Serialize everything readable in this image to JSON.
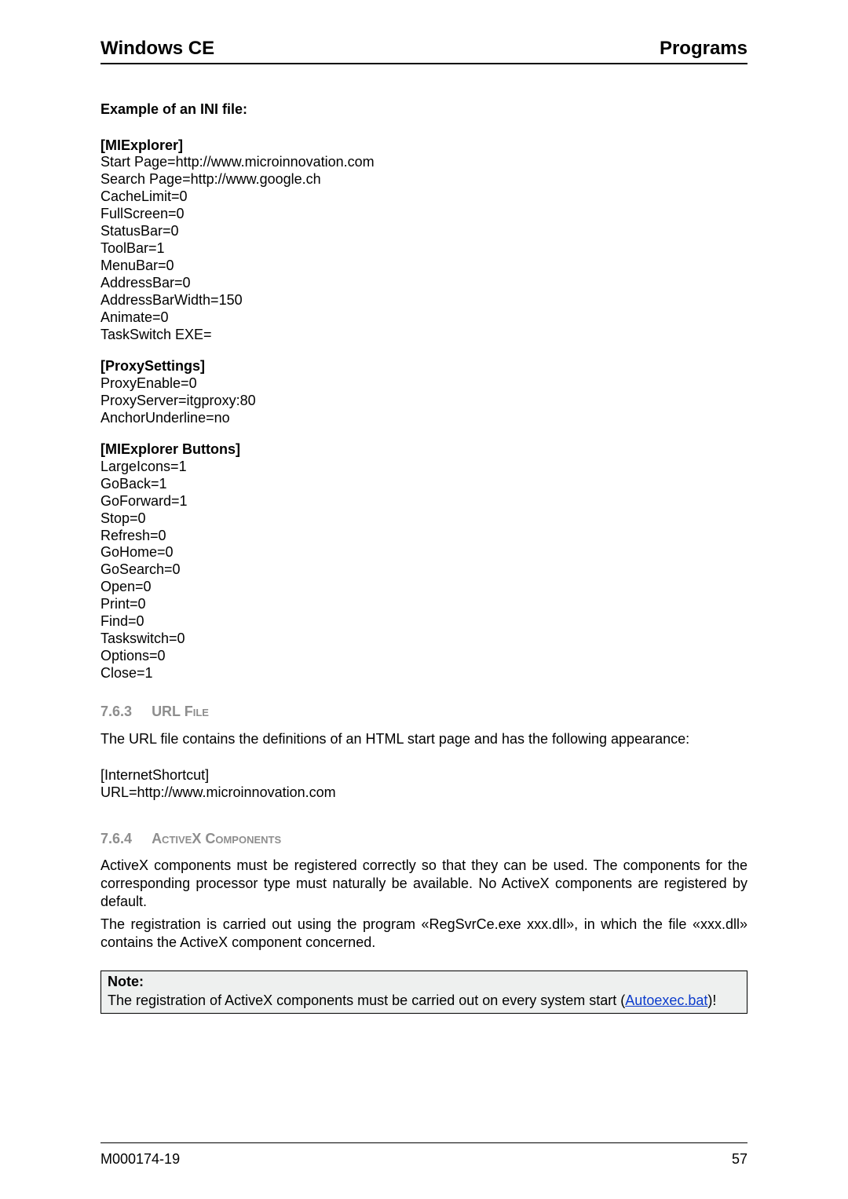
{
  "header": {
    "left": "Windows CE",
    "right": "Programs"
  },
  "exampleHeading": "Example of an INI file:",
  "ini": {
    "miExplorer": {
      "section": "[MIExplorer]",
      "lines": [
        "Start Page=http://www.microinnovation.com",
        "Search Page=http://www.google.ch",
        "CacheLimit=0",
        "FullScreen=0",
        "StatusBar=0",
        "ToolBar=1",
        "MenuBar=0",
        "AddressBar=0",
        "AddressBarWidth=150",
        "Animate=0",
        "TaskSwitch EXE="
      ]
    },
    "proxySettings": {
      "section": "[ProxySettings]",
      "lines": [
        "ProxyEnable=0",
        "ProxyServer=itgproxy:80",
        "AnchorUnderline=no"
      ]
    },
    "miExplorerButtons": {
      "section": "[MIExplorer Buttons]",
      "lines": [
        "LargeIcons=1",
        "GoBack=1",
        "GoForward=1",
        "Stop=0",
        "Refresh=0",
        "GoHome=0",
        "GoSearch=0",
        "Open=0",
        "Print=0",
        "Find=0",
        "Taskswitch=0",
        "Options=0",
        "Close=1"
      ]
    }
  },
  "section763": {
    "num": "7.6.3",
    "title": "URL File",
    "intro": "The URL file contains the definitions of an HTML start page and has the following appearance:",
    "lines": [
      "[InternetShortcut]",
      "URL=http://www.microinnovation.com"
    ]
  },
  "section764": {
    "num": "7.6.4",
    "title": "ActiveX Components",
    "para1": "ActiveX components must be registered correctly so that they can be used. The components for the corresponding processor type must naturally be available. No ActiveX components are registered by default.",
    "para2": "The registration is carried out using the program «RegSvrCe.exe xxx.dll», in which the file «xxx.dll» contains the ActiveX component concerned."
  },
  "note": {
    "label": "Note:",
    "textBefore": "The registration of ActiveX components must be carried out on every system start (",
    "linkText": "Autoexec.bat",
    "textAfter": ")!"
  },
  "footer": {
    "left": "M000174-19",
    "right": "57"
  }
}
